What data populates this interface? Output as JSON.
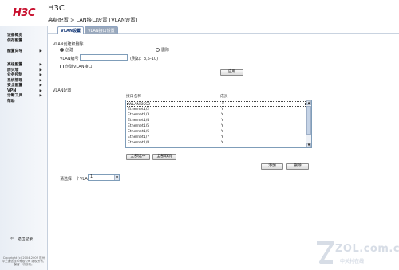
{
  "header": {
    "logo": "H3C",
    "brand": "H3C",
    "breadcrumb": "高级配置 > LAN接口设置 [VLAN设置]"
  },
  "tabs": [
    {
      "label": "VLAN设置",
      "active": true
    },
    {
      "label": "VLAN接口设置",
      "active": false
    }
  ],
  "sidebar": {
    "top_items": [
      {
        "label": "设备概览"
      },
      {
        "label": "保存配置"
      }
    ],
    "wizard": {
      "label": "配置向导"
    },
    "items": [
      {
        "label": "高级配置"
      },
      {
        "label": "防火墙"
      },
      {
        "label": "业务控制"
      },
      {
        "label": "系统管理"
      },
      {
        "label": "安全配置"
      },
      {
        "label": "VPN"
      },
      {
        "label": "诊断工具"
      },
      {
        "label": "帮助"
      }
    ],
    "logout_label": "退出登录",
    "copyright": "Copyright (c) 2004-2009 杭州华三通信技术有限公司 版权所有，保留一切权利。"
  },
  "form": {
    "section_create": "VLAN创建和删除",
    "radio_create": "创建",
    "radio_delete": "删除",
    "vlan_id_label": "VLAN编号",
    "vlan_id_value": "",
    "vlan_id_hint": "(例如：3,5-10)",
    "create_vlan_if_label": "创建VLAN接口",
    "apply_button": "应用",
    "section_config": "VLAN配置",
    "col_port": "接口名称",
    "col_member": "成员",
    "ports": [
      {
        "name": "WLAN-BSS0",
        "member": "Y",
        "selected": true
      },
      {
        "name": "Ethernet1/2",
        "member": "Y"
      },
      {
        "name": "Ethernet1/3",
        "member": "Y"
      },
      {
        "name": "Ethernet1/4",
        "member": "Y"
      },
      {
        "name": "Ethernet1/5",
        "member": "Y"
      },
      {
        "name": "Ethernet1/6",
        "member": "Y"
      },
      {
        "name": "Ethernet1/7",
        "member": "Y"
      },
      {
        "name": "Ethernet1/8",
        "member": "Y"
      }
    ],
    "select_all_button": "全部选中",
    "deselect_all_button": "全部取消",
    "add_button": "添加",
    "delete_button": "删除",
    "select_vlan_label": "请选择一个VLAN",
    "select_vlan_value": "1"
  },
  "watermark": {
    "main": "ZOL.com.cn",
    "sub": "中关村在线"
  }
}
